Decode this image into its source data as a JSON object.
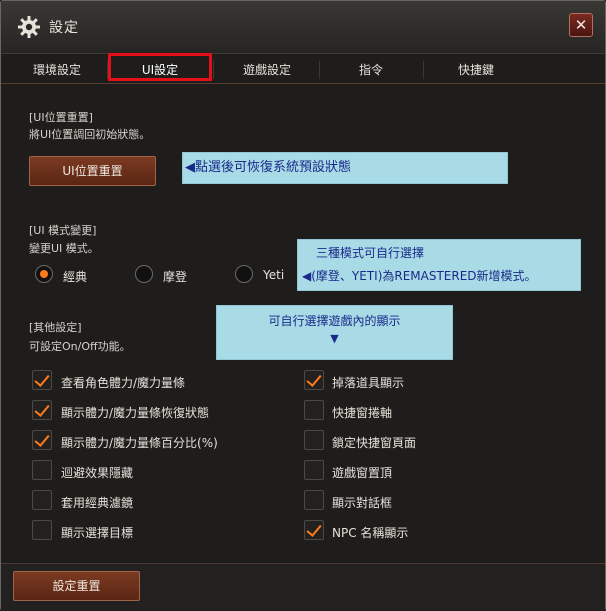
{
  "window": {
    "title": "設定",
    "close_label": "✕"
  },
  "tabs": [
    {
      "label": "環境設定"
    },
    {
      "label": "UI設定"
    },
    {
      "label": "遊戲設定"
    },
    {
      "label": "指令"
    },
    {
      "label": "快捷鍵"
    }
  ],
  "active_tab": "UI設定",
  "ui_reset": {
    "heading": "[UI位置重置]",
    "desc": "將UI位置調回初始狀態。",
    "button": "UI位置重置",
    "callout": "◀點選後可恢復系統預設狀態"
  },
  "ui_mode": {
    "heading": "[UI 模式變更]",
    "desc": "變更UI 模式。",
    "options": [
      {
        "label": "經典",
        "selected": true
      },
      {
        "label": "摩登",
        "selected": false
      },
      {
        "label": "Yeti",
        "selected": false
      }
    ],
    "callout_line1": "三種模式可自行選擇",
    "callout_line2": "◀(摩登、YETI)為REMASTERED新增模式。"
  },
  "other": {
    "heading": "[其他設定]",
    "desc": "可設定On/Off功能。",
    "callout_line1": "可自行選擇遊戲內的顯示",
    "callout_arrow": "▼",
    "left_options": [
      {
        "label": "查看角色體力/魔力量條",
        "checked": true
      },
      {
        "label": "顯示體力/魔力量條恢復狀態",
        "checked": true
      },
      {
        "label": "顯示體力/魔力量條百分比(%)",
        "checked": true
      },
      {
        "label": "迴避效果隱藏",
        "checked": false
      },
      {
        "label": "套用經典濾鏡",
        "checked": false
      },
      {
        "label": "顯示選擇目標",
        "checked": false
      }
    ],
    "right_options": [
      {
        "label": "掉落道具顯示",
        "checked": true
      },
      {
        "label": "快捷窗捲軸",
        "checked": false
      },
      {
        "label": "鎖定快捷窗頁面",
        "checked": false
      },
      {
        "label": "遊戲窗置頂",
        "checked": false
      },
      {
        "label": "顯示對話框",
        "checked": false
      },
      {
        "label": "NPC 名稱顯示",
        "checked": true
      }
    ]
  },
  "footer": {
    "reset_button": "設定重置"
  },
  "colors": {
    "accent": "#ff7a1a",
    "button": "#6a2f1a",
    "highlight": "#e3101a",
    "callout_bg": "#a9dbe6",
    "callout_text": "#1a2a8a"
  }
}
